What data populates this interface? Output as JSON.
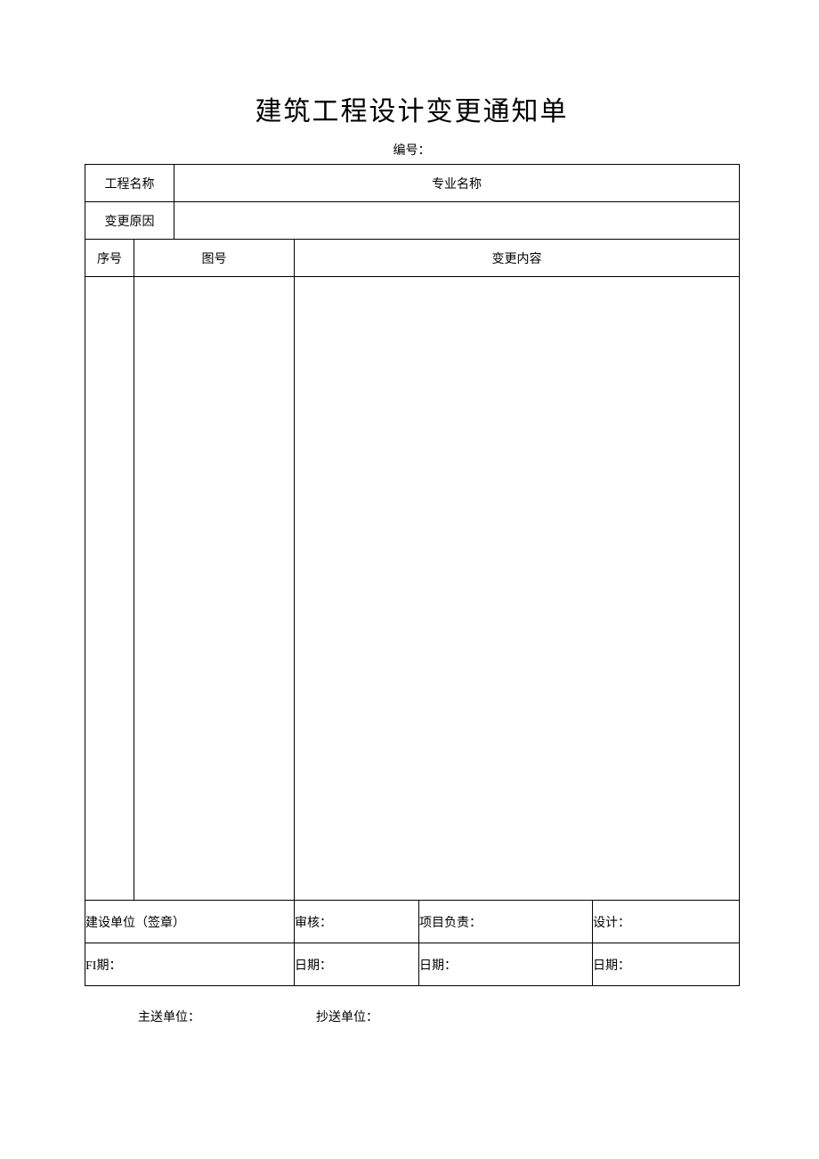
{
  "title": "建筑工程设计变更通知单",
  "serial_label": "编号：",
  "row1": {
    "project_name_label": "工程名称",
    "spec_name_label": "专业名称"
  },
  "row2": {
    "change_reason_label": "变更原因"
  },
  "header_row": {
    "seq_label": "序号",
    "drawing_no_label": "图号",
    "change_content_label": "变更内容"
  },
  "sign": {
    "construction_unit": "建设单位（签章）",
    "review": "审核：",
    "project_lead": "项目负责：",
    "design": "设计："
  },
  "dates": {
    "d1": "FI期：",
    "d2": "日期：",
    "d3": "日期：",
    "d4": "日期："
  },
  "footer": {
    "main_send": "主送单位：",
    "cc_send": "抄送单位："
  }
}
